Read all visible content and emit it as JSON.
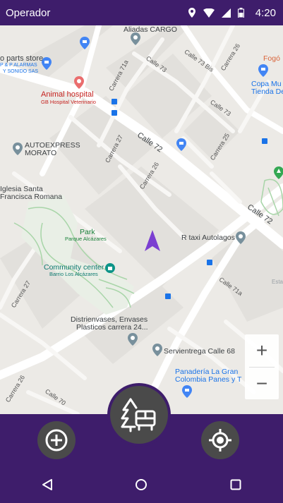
{
  "status_bar": {
    "title": "Operador",
    "time": "4:20"
  },
  "map": {
    "places": {
      "aliadas_cargo": "Aliadas CARGO",
      "parts_store": "o parts store",
      "alarmas_1": "P & P ALARMAS",
      "alarmas_2": "Y SONIDO SAS",
      "fogon": "Fogó",
      "copa_1": "Copa Mu",
      "copa_2": "Tienda De",
      "animal_hospital": "Animal hospital",
      "gb_hospital": "GB Hospital Veterinario",
      "autoexpress_1": "AUTOEXPRESS",
      "autoexpress_2": "MORATO",
      "iglesia_1": "Iglesia Santa",
      "iglesia_2": "Francisca Romana",
      "park": "Park",
      "parque": "Parque Alcázares",
      "rtaxi": "R taxi Autolagos",
      "community": "Community center",
      "barrio": "Barrio Los Alcázares",
      "esta": "Esta",
      "distrienvases_1": "Distrienvases, Envases",
      "distrienvases_2": "Plasticos carrera 24...",
      "servientrega": "Servientrega Calle 68",
      "panaderia_1": "Panadería La Gran",
      "panaderia_2": "Colombia Panes y T"
    },
    "streets": {
      "carrera_71a": "Carrera 71a",
      "calle_73": "Calle 73",
      "calle_73_bis": "Calle 73 Bis",
      "carrera_26_top": "Carrera 26",
      "calle_73_b": "Calle 73",
      "carrera_27_a": "Carrera 27",
      "calle_72": "Calle 72",
      "carrera_25": "Carrera 25",
      "carrera_26_mid": "Carrera 26",
      "calle_72_right": "Calle 72",
      "carrera_27_left": "Carrera 27",
      "calle_71a": "Calle 71a",
      "carrera_26_bottom": "Carrera 26",
      "calle_70": "Calle 70"
    },
    "zoom_in": "+",
    "zoom_out": "−"
  },
  "actions": {
    "add_icon": "plus-circle-icon",
    "center_icon": "tree-bus-icon",
    "locate_icon": "crosshair-icon"
  },
  "colors": {
    "brand": "#3e1d6b",
    "fab": "#4a4a4a",
    "map_bg": "#eceae6",
    "navigation_arrow": "#7b3fd1"
  }
}
